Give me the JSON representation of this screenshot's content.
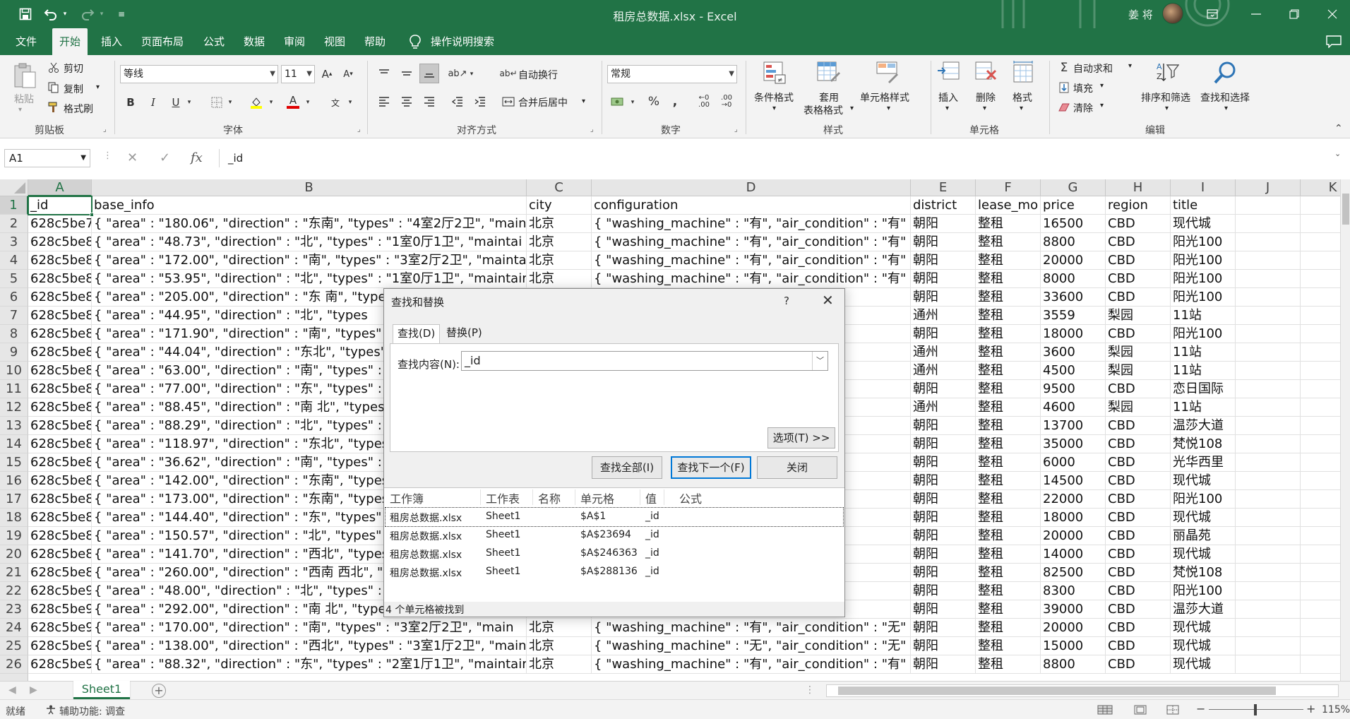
{
  "title_bar": {
    "doc_title": "租房总数据.xlsx  -  Excel",
    "user_name": "姜 将"
  },
  "menu_tabs": [
    "文件",
    "开始",
    "插入",
    "页面布局",
    "公式",
    "数据",
    "审阅",
    "视图",
    "帮助"
  ],
  "tell_me": "操作说明搜索",
  "ribbon": {
    "paste": "粘贴",
    "cut": "剪切",
    "copy": "复制",
    "format_painter": "格式刷",
    "group_clipboard": "剪贴板",
    "font_name": "等线",
    "font_size": "11",
    "group_font": "字体",
    "wrap_text": "自动换行",
    "merge_center": "合并后居中",
    "group_alignment": "对齐方式",
    "number_format": "常规",
    "group_number": "数字",
    "conditional_format": "条件格式",
    "format_table_1": "套用",
    "format_table_2": "表格格式",
    "cell_styles": "单元格样式",
    "group_styles": "样式",
    "insert": "插入",
    "delete": "删除",
    "format": "格式",
    "group_cells": "单元格",
    "autosum": "自动求和",
    "fill": "填充",
    "clear": "清除",
    "sort_filter": "排序和筛选",
    "find_select": "查找和选择",
    "group_editing": "编辑"
  },
  "formula_bar": {
    "name_box": "A1",
    "formula": "_id"
  },
  "columns": [
    "A",
    "B",
    "C",
    "D",
    "E",
    "F",
    "G",
    "H",
    "I",
    "J",
    "K"
  ],
  "rows": [
    {
      "n": "1",
      "cells": [
        "_id",
        "base_info",
        "city",
        "configuration",
        "district",
        "lease_mo",
        "price",
        "region",
        "title"
      ]
    },
    {
      "n": "2",
      "cells": [
        "628c5be7",
        "{ \"area\" : \"180.06\", \"direction\" : \"东南\", \"types\" : \"4室2厅2卫\", \"main",
        "北京",
        "{ \"washing_machine\" : \"有\", \"air_condition\" : \"有\"",
        "朝阳",
        "整租",
        "16500",
        "CBD",
        "现代城"
      ]
    },
    {
      "n": "3",
      "cells": [
        "628c5be8",
        "{ \"area\" : \"48.73\", \"direction\" : \"北\", \"types\" : \"1室0厅1卫\", \"maintai",
        "北京",
        "{ \"washing_machine\" : \"有\", \"air_condition\" : \"有\"",
        "朝阳",
        "整租",
        "8800",
        "CBD",
        "阳光100"
      ]
    },
    {
      "n": "4",
      "cells": [
        "628c5be8",
        "{ \"area\" : \"172.00\", \"direction\" : \"南\", \"types\" : \"3室2厅2卫\", \"mainta",
        "北京",
        "{ \"washing_machine\" : \"有\", \"air_condition\" : \"有\"",
        "朝阳",
        "整租",
        "20000",
        "CBD",
        "阳光100"
      ]
    },
    {
      "n": "5",
      "cells": [
        "628c5be8",
        "{ \"area\" : \"53.95\", \"direction\" : \"北\", \"types\" : \"1室0厅1卫\", \"maintair",
        "北京",
        "{ \"washing_machine\" : \"有\", \"air_condition\" : \"有\"",
        "朝阳",
        "整租",
        "8000",
        "CBD",
        "阳光100"
      ]
    },
    {
      "n": "6",
      "cells": [
        "628c5be8",
        "{ \"area\" : \"205.00\", \"direction\" : \"东 南\", \"type",
        "",
        "ction\" : \"无\"",
        "朝阳",
        "整租",
        "33600",
        "CBD",
        "阳光100"
      ]
    },
    {
      "n": "7",
      "cells": [
        "628c5be8",
        "{ \"area\" : \"44.95\", \"direction\" : \"北\", \"types",
        "",
        "ction\" : \"有\"",
        "通州",
        "整租",
        "3559",
        "梨园",
        "11站"
      ]
    },
    {
      "n": "8",
      "cells": [
        "628c5be8",
        "{ \"area\" : \"171.90\", \"direction\" : \"南\", \"types\"",
        "",
        "ction\" : \"有\"",
        "朝阳",
        "整租",
        "18000",
        "CBD",
        "阳光100"
      ]
    },
    {
      "n": "9",
      "cells": [
        "628c5be8",
        "{ \"area\" : \"44.04\", \"direction\" : \"东北\", \"types\"",
        "",
        "ction\" : \"有\"",
        "通州",
        "整租",
        "3600",
        "梨园",
        "11站"
      ]
    },
    {
      "n": "10",
      "cells": [
        "628c5be8",
        "{ \"area\" : \"63.00\", \"direction\" : \"南\", \"types\" :",
        "",
        "ction\" : \"有\"",
        "通州",
        "整租",
        "4500",
        "梨园",
        "11站"
      ]
    },
    {
      "n": "11",
      "cells": [
        "628c5be8",
        "{ \"area\" : \"77.00\", \"direction\" : \"东\", \"types\" :",
        "",
        "ction\" : \"无\"",
        "朝阳",
        "整租",
        "9500",
        "CBD",
        "恋日国际"
      ]
    },
    {
      "n": "12",
      "cells": [
        "628c5be8",
        "{ \"area\" : \"88.45\", \"direction\" : \"南 北\", \"types",
        "",
        "ction\" : \"有\"",
        "通州",
        "整租",
        "4600",
        "梨园",
        "11站"
      ]
    },
    {
      "n": "13",
      "cells": [
        "628c5be8",
        "{ \"area\" : \"88.29\", \"direction\" : \"北\", \"types\" :",
        "",
        "ction\" : \"有\"",
        "朝阳",
        "整租",
        "13700",
        "CBD",
        "温莎大道"
      ]
    },
    {
      "n": "14",
      "cells": [
        "628c5be8",
        "{ \"area\" : \"118.97\", \"direction\" : \"东北\", \"types",
        "",
        "ction\" : \"有\"",
        "朝阳",
        "整租",
        "35000",
        "CBD",
        "梵悦108"
      ]
    },
    {
      "n": "15",
      "cells": [
        "628c5be8",
        "{ \"area\" : \"36.62\", \"direction\" : \"南\", \"types\" :",
        "",
        "ction\" : \"有\"",
        "朝阳",
        "整租",
        "6000",
        "CBD",
        "光华西里"
      ]
    },
    {
      "n": "16",
      "cells": [
        "628c5be8",
        "{ \"area\" : \"142.00\", \"direction\" : \"东南\", \"types",
        "",
        "ction\" : \"有\"",
        "朝阳",
        "整租",
        "14500",
        "CBD",
        "现代城"
      ]
    },
    {
      "n": "17",
      "cells": [
        "628c5be8",
        "{ \"area\" : \"173.00\", \"direction\" : \"东南\", \"types",
        "",
        "ction\" : \"有\"",
        "朝阳",
        "整租",
        "22000",
        "CBD",
        "阳光100"
      ]
    },
    {
      "n": "18",
      "cells": [
        "628c5be8",
        "{ \"area\" : \"144.40\", \"direction\" : \"东\", \"types\"",
        "",
        "ction\" : \"有\"",
        "朝阳",
        "整租",
        "18000",
        "CBD",
        "现代城"
      ]
    },
    {
      "n": "19",
      "cells": [
        "628c5be8",
        "{ \"area\" : \"150.57\", \"direction\" : \"北\", \"types\"",
        "",
        "ction\" : \"有\"",
        "朝阳",
        "整租",
        "20000",
        "CBD",
        "丽晶苑"
      ]
    },
    {
      "n": "20",
      "cells": [
        "628c5be8",
        "{ \"area\" : \"141.70\", \"direction\" : \"西北\", \"types",
        "",
        "ction\" : \"有\"",
        "朝阳",
        "整租",
        "14000",
        "CBD",
        "现代城"
      ]
    },
    {
      "n": "21",
      "cells": [
        "628c5be8",
        "{ \"area\" : \"260.00\", \"direction\" : \"西南 西北\", \"",
        "",
        "ction\" : \"无\"",
        "朝阳",
        "整租",
        "82500",
        "CBD",
        "梵悦108"
      ]
    },
    {
      "n": "22",
      "cells": [
        "628c5be9",
        "{ \"area\" : \"48.00\", \"direction\" : \"北\", \"types\" :",
        "",
        "ction\" : \"有\"",
        "朝阳",
        "整租",
        "8300",
        "CBD",
        "阳光100"
      ]
    },
    {
      "n": "23",
      "cells": [
        "628c5be9",
        "{ \"area\" : \"292.00\", \"direction\" : \"南 北\", \"type",
        "",
        "ction\" : \"无\"",
        "朝阳",
        "整租",
        "39000",
        "CBD",
        "温莎大道"
      ]
    },
    {
      "n": "24",
      "cells": [
        "628c5be9",
        "{ \"area\" : \"170.00\", \"direction\" : \"南\", \"types\" : \"3室2厅2卫\", \"main",
        "北京",
        "{ \"washing_machine\" : \"有\", \"air_condition\" : \"无\"",
        "朝阳",
        "整租",
        "20000",
        "CBD",
        "现代城"
      ]
    },
    {
      "n": "25",
      "cells": [
        "628c5be9",
        "{ \"area\" : \"138.00\", \"direction\" : \"西北\", \"types\" : \"3室1厅2卫\", \"main",
        "北京",
        "{ \"washing_machine\" : \"无\", \"air_condition\" : \"无\"",
        "朝阳",
        "整租",
        "15000",
        "CBD",
        "现代城"
      ]
    },
    {
      "n": "26",
      "cells": [
        "628c5be9",
        "{ \"area\" : \"88.32\", \"direction\" : \"东\", \"types\" : \"2室1厅1卫\", \"maintair",
        "北京",
        "{ \"washing_machine\" : \"有\", \"air_condition\" : \"有\"",
        "朝阳",
        "整租",
        "8800",
        "CBD",
        "现代城"
      ]
    }
  ],
  "sheet_tab": "Sheet1",
  "status": {
    "ready": "就绪",
    "accessibility": "辅助功能: 调查",
    "zoom": "115%"
  },
  "dialog": {
    "title": "查找和替换",
    "help": "?",
    "tab_find": "查找(D)",
    "tab_replace": "替换(P)",
    "find_label": "查找内容(N):",
    "find_value": "_id",
    "options_button": "选项(T) >>",
    "find_all": "查找全部(I)",
    "find_next": "查找下一个(F)",
    "close": "关闭",
    "result_headers": [
      "工作簿",
      "工作表",
      "名称",
      "单元格",
      "值",
      "公式"
    ],
    "results": [
      {
        "book": "租房总数据.xlsx",
        "sheet": "Sheet1",
        "cell": "$A$1",
        "value": "_id"
      },
      {
        "book": "租房总数据.xlsx",
        "sheet": "Sheet1",
        "cell": "$A$23694",
        "value": "_id"
      },
      {
        "book": "租房总数据.xlsx",
        "sheet": "Sheet1",
        "cell": "$A$246363",
        "value": "_id"
      },
      {
        "book": "租房总数据.xlsx",
        "sheet": "Sheet1",
        "cell": "$A$288136",
        "value": "_id"
      }
    ],
    "status": "4 个单元格被找到"
  },
  "colors": {
    "excel_green": "#217346",
    "ribbon_bg": "#f3f3f3",
    "selection": "#217346"
  }
}
